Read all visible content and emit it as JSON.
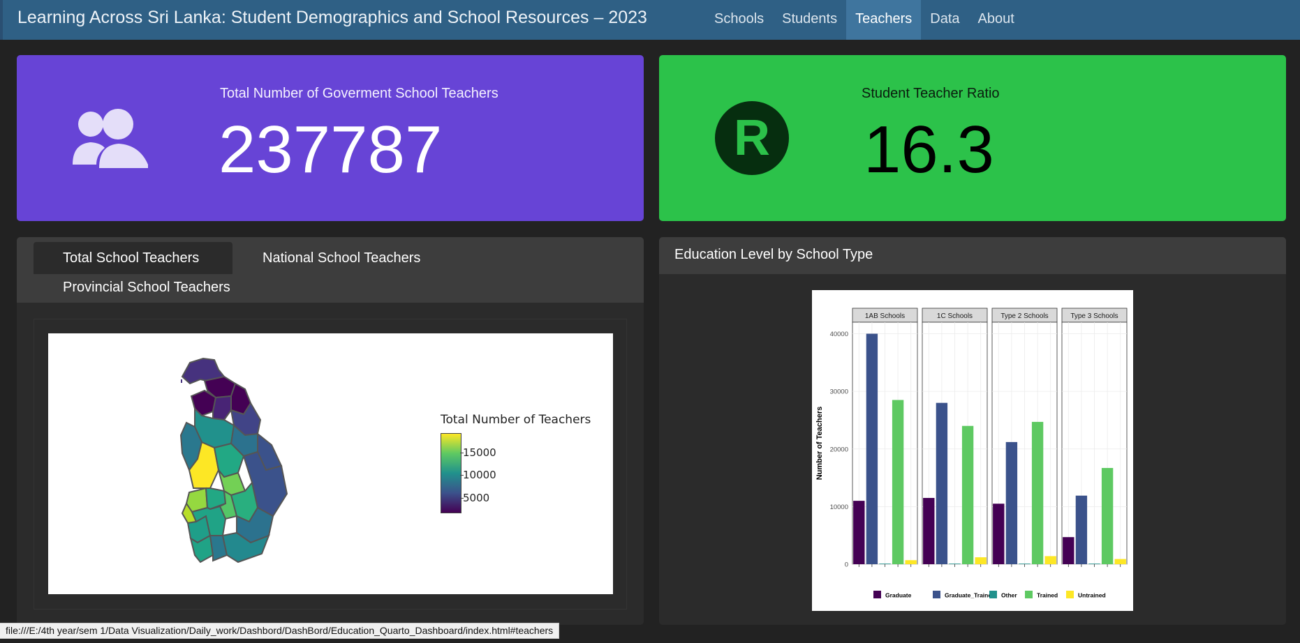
{
  "navbar": {
    "title": "Learning Across Sri Lanka: Student Demographics and School Resources – 2023",
    "links": [
      {
        "label": "Schools",
        "active": false
      },
      {
        "label": "Students",
        "active": false
      },
      {
        "label": "Teachers",
        "active": true
      },
      {
        "label": "Data",
        "active": false
      },
      {
        "label": "About",
        "active": false
      }
    ]
  },
  "value_boxes": {
    "teachers": {
      "label": "Total Number of Goverment School Teachers",
      "value": "237787",
      "icon": "people-icon",
      "color": "#6744d6"
    },
    "ratio": {
      "label": "Student Teacher Ratio",
      "value": "16.3",
      "icon": "r-logo-icon",
      "icon_text": "R",
      "color": "#2cc24a"
    }
  },
  "map_card": {
    "tabs": [
      "Total School Teachers",
      "National School Teachers",
      "Provincial School Teachers"
    ],
    "active_tab": "Total School Teachers",
    "legend_title": "Total Number of Teachers",
    "legend_ticks": [
      "15000",
      "10000",
      "5000"
    ],
    "colorscale": [
      "#440154",
      "#3b528b",
      "#21918c",
      "#5ec962",
      "#fde725"
    ]
  },
  "chart_card": {
    "title": "Education Level by School Type"
  },
  "chart_data": {
    "type": "bar",
    "facets": [
      "1AB Schools",
      "1C Schools",
      "Type 2 Schools",
      "Type 3 Schools"
    ],
    "ylabel": "Number of Teachers",
    "xlabel": "",
    "ylim": [
      0,
      42000
    ],
    "yticks": [
      "0",
      "10000",
      "20000",
      "30000",
      "40000"
    ],
    "grid": true,
    "legend_position": "bottom",
    "series": [
      {
        "name": "Graduate",
        "color": "#440154",
        "values": [
          11000,
          11500,
          10500,
          4700
        ]
      },
      {
        "name": "Graduate_Trained",
        "color": "#3b528b",
        "values": [
          40000,
          28000,
          21200,
          11900
        ]
      },
      {
        "name": "Other",
        "color": "#21918c",
        "values": [
          100,
          100,
          100,
          100
        ]
      },
      {
        "name": "Trained",
        "color": "#5ec962",
        "values": [
          28500,
          24000,
          24700,
          16700
        ]
      },
      {
        "name": "Untrained",
        "color": "#fde725",
        "values": [
          700,
          1200,
          1400,
          900
        ]
      }
    ]
  },
  "status_bar": {
    "text": "file:///E:/4th year/sem 1/Data Visualization/Daily_work/Dashbord/DashBord/Education_Quarto_Dashboard/index.html#teachers"
  }
}
